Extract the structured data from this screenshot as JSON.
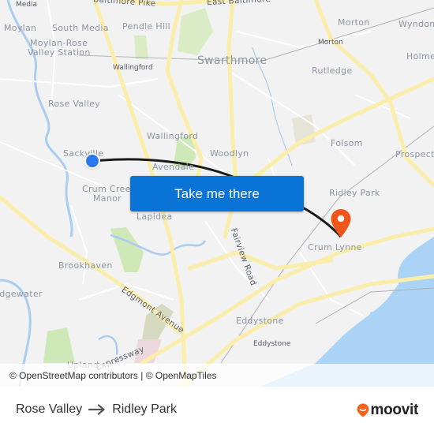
{
  "map": {
    "places": [
      {
        "id": "media",
        "label": "Media"
      },
      {
        "id": "moylan",
        "label": "Moylan"
      },
      {
        "id": "south-media",
        "label": "South Media"
      },
      {
        "id": "moylan-rose-valley-station-1",
        "label": "Moylan-Rose"
      },
      {
        "id": "moylan-rose-valley-station-2",
        "label": "Valley Station"
      },
      {
        "id": "pendle-hill",
        "label": "Pendle Hill"
      },
      {
        "id": "baltimore-pike",
        "label": "Baltimore Pike"
      },
      {
        "id": "east-baltimore",
        "label": "East Baltimore"
      },
      {
        "id": "wallingford-station",
        "label": "Wallingford"
      },
      {
        "id": "swarthmore",
        "label": "Swarthmore"
      },
      {
        "id": "morton",
        "label": "Morton"
      },
      {
        "id": "morton-station",
        "label": "Morton"
      },
      {
        "id": "wyndom",
        "label": "Wyndom"
      },
      {
        "id": "holme",
        "label": "Holme"
      },
      {
        "id": "rutledge",
        "label": "Rutledge"
      },
      {
        "id": "rose-valley",
        "label": "Rose Valley"
      },
      {
        "id": "wallingford",
        "label": "Wallingford"
      },
      {
        "id": "sackville",
        "label": "Sackville"
      },
      {
        "id": "woodlyn",
        "label": "Woodlyn"
      },
      {
        "id": "folsom",
        "label": "Folsom"
      },
      {
        "id": "prospect",
        "label": "Prospect"
      },
      {
        "id": "avendale",
        "label": "Avendale"
      },
      {
        "id": "crum-creek-manor-1",
        "label": "Crum Creek"
      },
      {
        "id": "crum-creek-manor-2",
        "label": "Manor"
      },
      {
        "id": "lapidea",
        "label": "Lapidea"
      },
      {
        "id": "ridley-park",
        "label": "Ridley Park"
      },
      {
        "id": "fairview-road",
        "label": "Fairview Road"
      },
      {
        "id": "crum-lynne",
        "label": "Crum Lynne"
      },
      {
        "id": "brookhaven",
        "label": "Brookhaven"
      },
      {
        "id": "edgewater",
        "label": "Edgewater"
      },
      {
        "id": "edgmont-avenue",
        "label": "Edgmont Avenue"
      },
      {
        "id": "eddystone",
        "label": "Eddystone"
      },
      {
        "id": "eddystone-station",
        "label": "Eddystone"
      },
      {
        "id": "upland",
        "label": "Upland"
      },
      {
        "id": "expressway",
        "label": "Expressway"
      }
    ],
    "origin": {
      "label": "Rose Valley",
      "color": "#2a78ee"
    },
    "destination": {
      "label": "Ridley Park",
      "color": "#f0551a"
    },
    "route_color": "#1a1a1a",
    "attribution": "© OpenStreetMap contributors | © OpenMapTiles"
  },
  "cta": {
    "label": "Take me there",
    "color": "#0a73d6"
  },
  "footer": {
    "from": "Rose Valley",
    "to": "Ridley Park",
    "brand": "moovit",
    "brand_color": "#f3651f"
  }
}
